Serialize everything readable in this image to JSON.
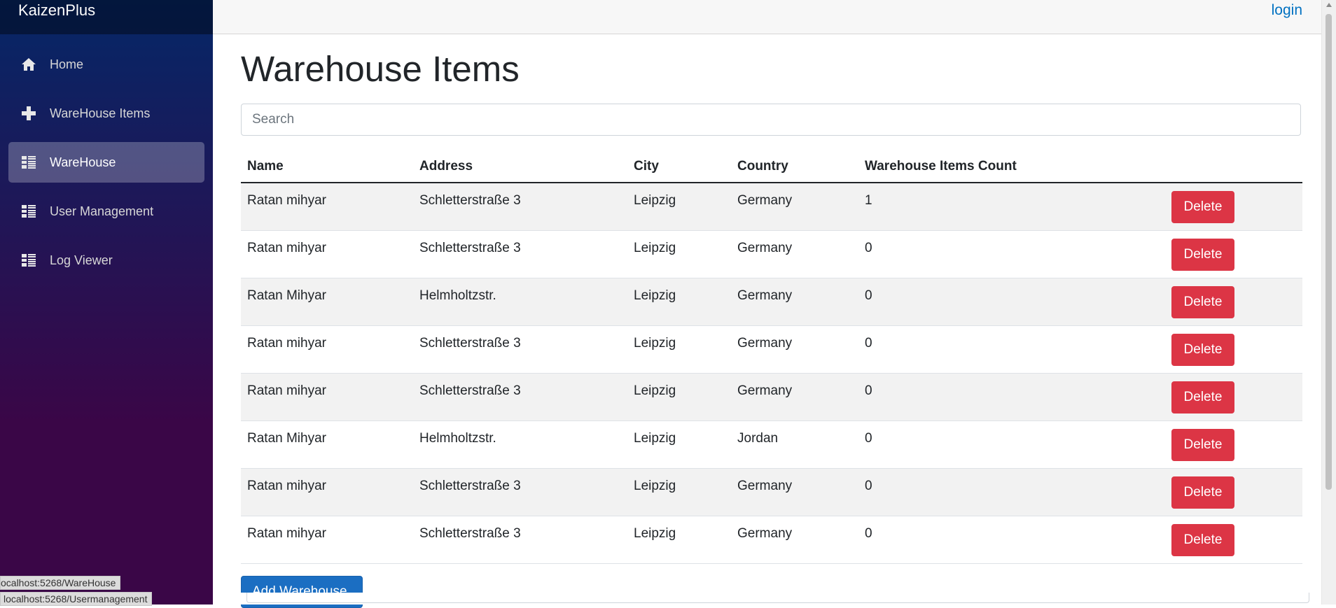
{
  "app": {
    "brand": "KaizenPlus"
  },
  "top": {
    "login_label": "login"
  },
  "sidebar": {
    "items": [
      {
        "label": "Home",
        "icon": "home-icon"
      },
      {
        "label": "WareHouse Items",
        "icon": "plus-icon"
      },
      {
        "label": "WareHouse",
        "icon": "list-icon",
        "active": true
      },
      {
        "label": "User Management",
        "icon": "list-icon"
      },
      {
        "label": "Log Viewer",
        "icon": "list-icon"
      }
    ]
  },
  "main": {
    "title": "Warehouse Items",
    "search": {
      "placeholder": "Search",
      "value": ""
    },
    "table": {
      "columns": [
        "Name",
        "Address",
        "City",
        "Country",
        "Warehouse Items Count",
        ""
      ],
      "rows": [
        {
          "name": "Ratan mihyar",
          "address": "Schletterstraße 3",
          "city": "Leipzig",
          "country": "Germany",
          "count": "1",
          "action": "Delete"
        },
        {
          "name": "Ratan mihyar",
          "address": "Schletterstraße 3",
          "city": "Leipzig",
          "country": "Germany",
          "count": "0",
          "action": "Delete"
        },
        {
          "name": "Ratan Mihyar",
          "address": "Helmholtzstr.",
          "city": "Leipzig",
          "country": "Germany",
          "count": "0",
          "action": "Delete"
        },
        {
          "name": "Ratan mihyar",
          "address": "Schletterstraße 3",
          "city": "Leipzig",
          "country": "Germany",
          "count": "0",
          "action": "Delete"
        },
        {
          "name": "Ratan mihyar",
          "address": "Schletterstraße 3",
          "city": "Leipzig",
          "country": "Germany",
          "count": "0",
          "action": "Delete"
        },
        {
          "name": "Ratan Mihyar",
          "address": "Helmholtzstr.",
          "city": "Leipzig",
          "country": "Jordan",
          "count": "0",
          "action": "Delete"
        },
        {
          "name": "Ratan mihyar",
          "address": "Schletterstraße 3",
          "city": "Leipzig",
          "country": "Germany",
          "count": "0",
          "action": "Delete"
        },
        {
          "name": "Ratan mihyar",
          "address": "Schletterstraße 3",
          "city": "Leipzig",
          "country": "Germany",
          "count": "0",
          "action": "Delete"
        }
      ]
    },
    "add_button_label": "Add Warehouse"
  },
  "status": {
    "link_1": "ocalhost:5268/WareHouse",
    "link_2": "localhost:5268/Usermanagement"
  },
  "colors": {
    "danger": "#dc3545",
    "primary": "#1b6ec2",
    "link": "#0071c1",
    "sidebar_top": "#052767",
    "sidebar_bottom": "#3a0647"
  }
}
